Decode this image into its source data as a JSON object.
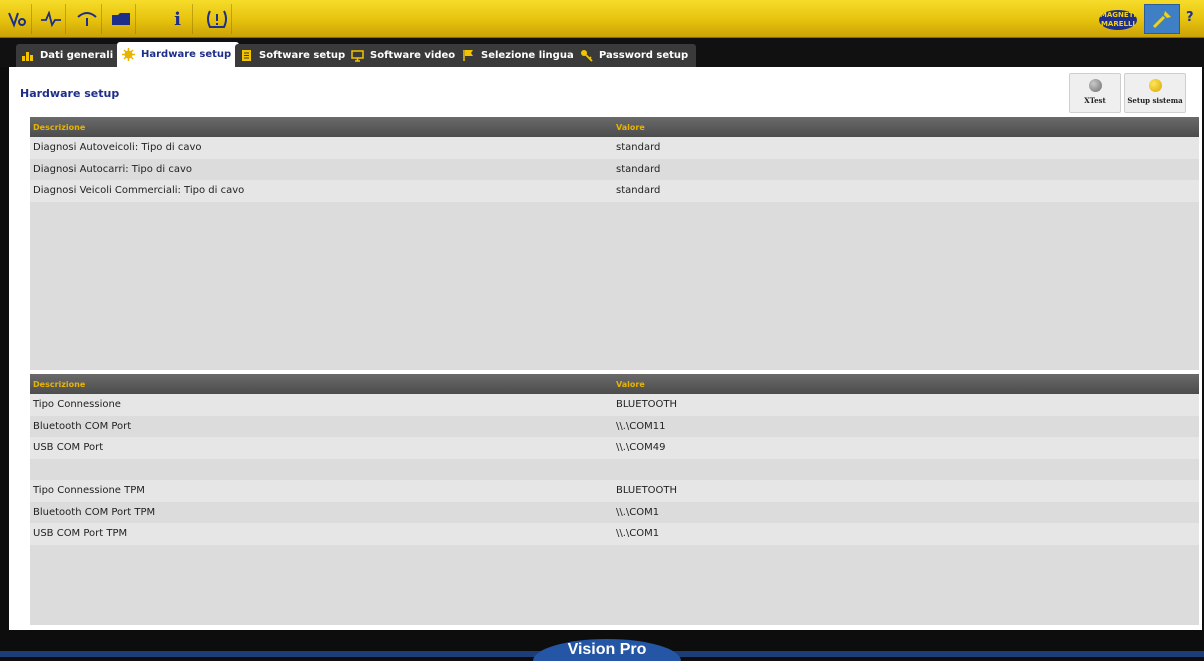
{
  "toolbar": {
    "icons": [
      "vehicle-diagnosis-icon",
      "oscilloscope-icon",
      "wireless-icon",
      "folder-icon",
      "info-icon",
      "tpms-warning-icon"
    ],
    "brand": "MAGNETI MARELLI",
    "help_label": "?"
  },
  "tabs": [
    {
      "label": "Dati generali",
      "icon": "chart-icon"
    },
    {
      "label": "Hardware setup",
      "icon": "gear-icon",
      "active": true
    },
    {
      "label": "Software setup",
      "icon": "document-icon"
    },
    {
      "label": "Software video",
      "icon": "monitor-icon"
    },
    {
      "label": "Selezione lingua",
      "icon": "flag-icon"
    },
    {
      "label": "Password setup",
      "icon": "key-icon"
    }
  ],
  "panel": {
    "title": "Hardware setup",
    "buttons": [
      {
        "label": "XTest",
        "icon": "globe-icon"
      },
      {
        "label": "Setup sistema",
        "icon": "wrench-icon"
      }
    ]
  },
  "table1": {
    "headers": [
      "Descrizione",
      "Valore"
    ],
    "rows": [
      [
        "Diagnosi Autoveicoli: Tipo di cavo",
        "standard"
      ],
      [
        "Diagnosi Autocarri: Tipo di cavo",
        "standard"
      ],
      [
        "Diagnosi Veicoli Commerciali: Tipo di cavo",
        "standard"
      ]
    ]
  },
  "table2": {
    "headers": [
      "Descrizione",
      "Valore"
    ],
    "rows": [
      [
        "Tipo Connessione",
        "BLUETOOTH"
      ],
      [
        "Bluetooth COM Port",
        "\\\\.\\COM11"
      ],
      [
        "USB COM Port",
        "\\\\.\\COM49"
      ],
      [
        "",
        ""
      ],
      [
        "Tipo Connessione TPM",
        "BLUETOOTH"
      ],
      [
        "Bluetooth COM Port TPM",
        "\\\\.\\COM1"
      ],
      [
        "USB COM Port TPM",
        "\\\\.\\COM1"
      ]
    ]
  },
  "footer": {
    "product": "Vision Pro"
  }
}
